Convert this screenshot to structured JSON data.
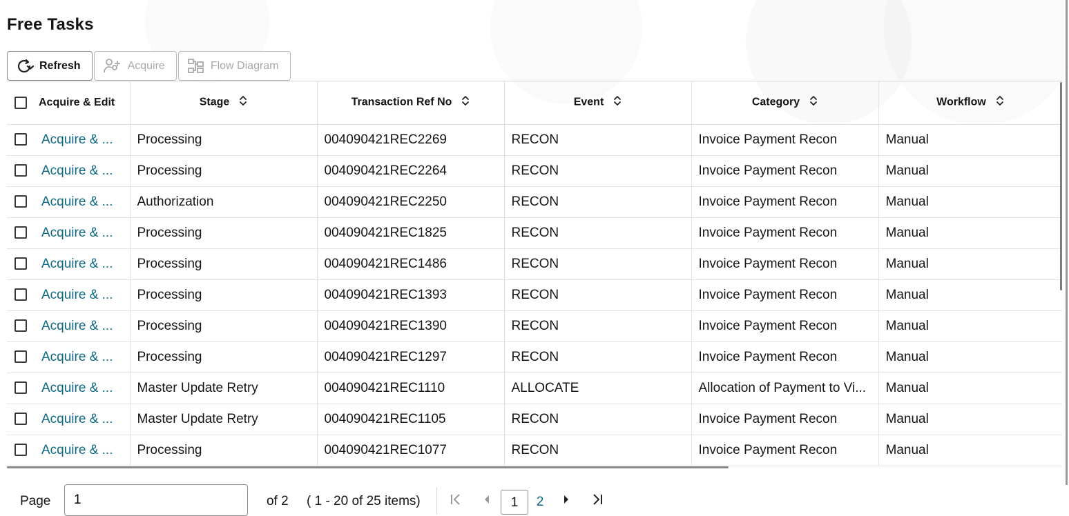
{
  "page": {
    "title": "Free Tasks"
  },
  "toolbar": {
    "refresh_label": "Refresh",
    "acquire_label": "Acquire",
    "flow_label": "Flow Diagram"
  },
  "table": {
    "columns": [
      "Acquire & Edit",
      "Stage",
      "Transaction Ref No",
      "Event",
      "Category",
      "Workflow"
    ],
    "rows": [
      {
        "action": "Acquire & ...",
        "stage": "Processing",
        "ref": "004090421REC2269",
        "event": "RECON",
        "category": "Invoice Payment Recon",
        "workflow": "Manual"
      },
      {
        "action": "Acquire & ...",
        "stage": "Processing",
        "ref": "004090421REC2264",
        "event": "RECON",
        "category": "Invoice Payment Recon",
        "workflow": "Manual"
      },
      {
        "action": "Acquire & ...",
        "stage": "Authorization",
        "ref": "004090421REC2250",
        "event": "RECON",
        "category": "Invoice Payment Recon",
        "workflow": "Manual"
      },
      {
        "action": "Acquire & ...",
        "stage": "Processing",
        "ref": "004090421REC1825",
        "event": "RECON",
        "category": "Invoice Payment Recon",
        "workflow": "Manual"
      },
      {
        "action": "Acquire & ...",
        "stage": "Processing",
        "ref": "004090421REC1486",
        "event": "RECON",
        "category": "Invoice Payment Recon",
        "workflow": "Manual"
      },
      {
        "action": "Acquire & ...",
        "stage": "Processing",
        "ref": "004090421REC1393",
        "event": "RECON",
        "category": "Invoice Payment Recon",
        "workflow": "Manual"
      },
      {
        "action": "Acquire & ...",
        "stage": "Processing",
        "ref": "004090421REC1390",
        "event": "RECON",
        "category": "Invoice Payment Recon",
        "workflow": "Manual"
      },
      {
        "action": "Acquire & ...",
        "stage": "Processing",
        "ref": "004090421REC1297",
        "event": "RECON",
        "category": "Invoice Payment Recon",
        "workflow": "Manual"
      },
      {
        "action": "Acquire & ...",
        "stage": "Master Update Retry",
        "ref": "004090421REC1110",
        "event": "ALLOCATE",
        "category": "Allocation of Payment to Vi...",
        "workflow": "Manual"
      },
      {
        "action": "Acquire & ...",
        "stage": "Master Update Retry",
        "ref": "004090421REC1105",
        "event": "RECON",
        "category": "Invoice Payment Recon",
        "workflow": "Manual"
      },
      {
        "action": "Acquire & ...",
        "stage": "Processing",
        "ref": "004090421REC1077",
        "event": "RECON",
        "category": "Invoice Payment Recon",
        "workflow": "Manual"
      }
    ]
  },
  "pager": {
    "page_label": "Page",
    "page_value": "1",
    "of_label": "of 2",
    "range_label": "( 1 - 20 of 25 items)",
    "pages": [
      "1",
      "2"
    ]
  },
  "colors": {
    "link": "#0e6a84",
    "border": "#8a8a8a"
  }
}
